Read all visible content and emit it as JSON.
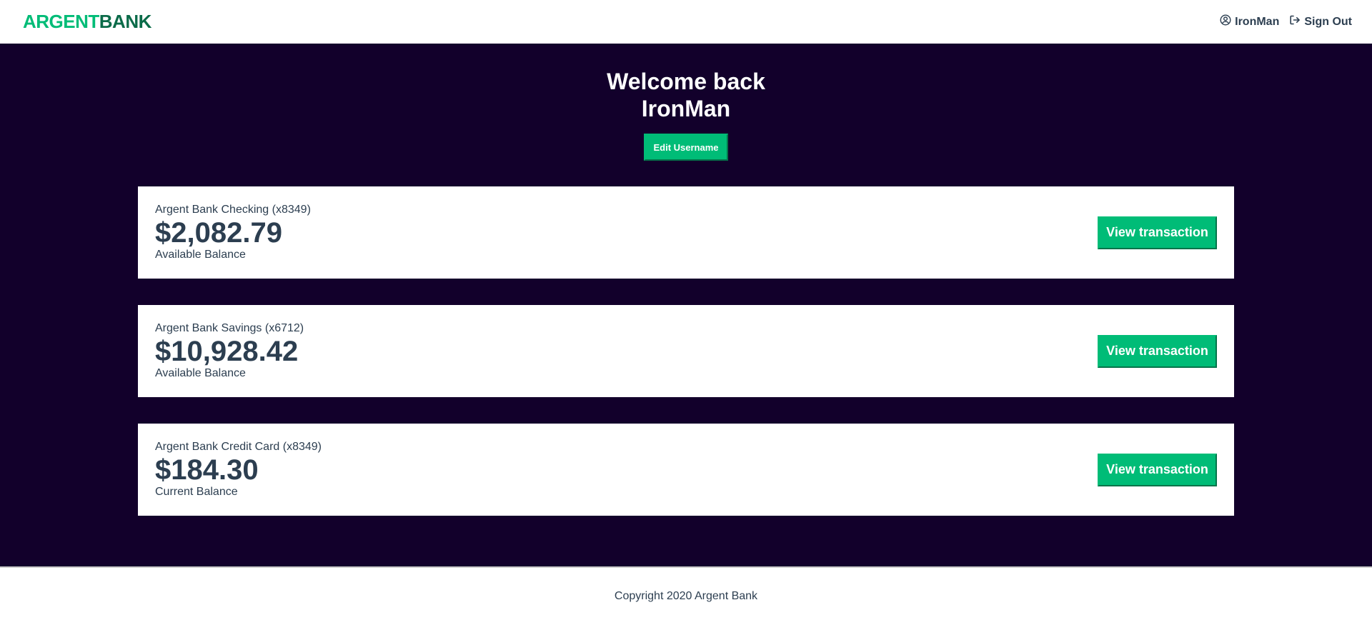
{
  "nav": {
    "logo_part1": "ARGENT",
    "logo_part2": "BANK",
    "user_label": "IronMan",
    "user_icon": "user-circle-icon",
    "signout_label": "Sign Out",
    "signout_icon": "sign-out-icon"
  },
  "header": {
    "greeting": "Welcome back",
    "username": "IronMan",
    "edit_button": "Edit Username"
  },
  "accounts": [
    {
      "title": "Argent Bank Checking (x8349)",
      "amount": "$2,082.79",
      "description": "Available Balance",
      "button": "View transaction"
    },
    {
      "title": "Argent Bank Savings (x6712)",
      "amount": "$10,928.42",
      "description": "Available Balance",
      "button": "View transaction"
    },
    {
      "title": "Argent Bank Credit Card (x8349)",
      "amount": "$184.30",
      "description": "Current Balance",
      "button": "View transaction"
    }
  ],
  "footer": {
    "copyright": "Copyright 2020 Argent Bank"
  },
  "colors": {
    "accent": "#00bc77",
    "background_dark": "#12002b",
    "text": "#2c3e50"
  }
}
